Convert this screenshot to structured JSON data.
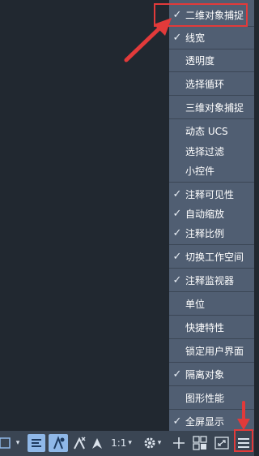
{
  "menu": {
    "items": [
      {
        "label": "二维对象捕捉",
        "checked": true
      },
      {
        "label": "线宽",
        "checked": true
      },
      {
        "label": "透明度",
        "checked": false
      },
      {
        "label": "选择循环",
        "checked": false
      },
      {
        "label": "三维对象捕捉",
        "checked": false
      },
      {
        "label": "动态 UCS",
        "checked": false
      },
      {
        "label": "选择过滤",
        "checked": false
      },
      {
        "label": "小控件",
        "checked": false
      },
      {
        "label": "注释可见性",
        "checked": true
      },
      {
        "label": "自动缩放",
        "checked": true
      },
      {
        "label": "注释比例",
        "checked": true
      },
      {
        "label": "切换工作空间",
        "checked": true
      },
      {
        "label": "注释监视器",
        "checked": true
      },
      {
        "label": "单位",
        "checked": false
      },
      {
        "label": "快捷特性",
        "checked": false
      },
      {
        "label": "锁定用户界面",
        "checked": false
      },
      {
        "label": "隔离对象",
        "checked": true
      },
      {
        "label": "图形性能",
        "checked": false
      },
      {
        "label": "全屏显示",
        "checked": true
      }
    ],
    "check_glyph": "✓"
  },
  "statusbar": {
    "scale_label": "1:1",
    "caret": "▾",
    "icons": [
      "selection-cycling-icon",
      "lineweight-icon",
      "annotation-visibility-icon",
      "auto-scale-icon",
      "annotation-scale-icon",
      "workspace-gear-icon",
      "plus-icon",
      "isolate-objects-icon",
      "fullscreen-icon",
      "customization-menu-icon"
    ]
  },
  "colors": {
    "canvas": "#212830",
    "menu": "#505e72",
    "statusbar": "#3a4553",
    "annotation": "#e23a3a",
    "active_button": "#8fb8e8"
  }
}
